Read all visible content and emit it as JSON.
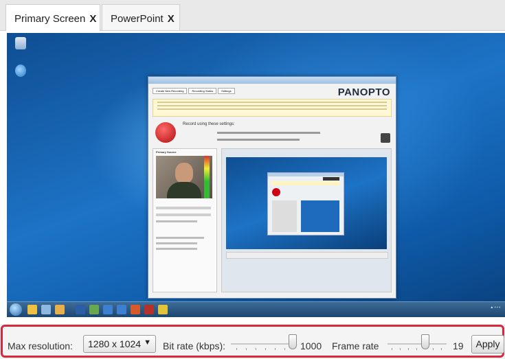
{
  "tabs": [
    {
      "label": "Primary Screen",
      "close": "X"
    },
    {
      "label": "PowerPoint",
      "close": "X"
    }
  ],
  "controls": {
    "max_resolution_label": "Max resolution:",
    "max_resolution_value": "1280 x 1024",
    "dropdown_arrow": "▼",
    "bitrate_label": "Bit rate (kbps):",
    "bitrate_value": "1000",
    "framerate_label": "Frame rate",
    "framerate_value": "19",
    "apply_label": "Apply"
  },
  "preview": {
    "logo": "PANOPTO",
    "window_tabs": [
      "Create New Recording",
      "Recording Status",
      "Settings"
    ],
    "record_heading": "Record using these settings:",
    "primary_source_label": "Primary Source"
  },
  "colors": {
    "highlight": "#d8283b",
    "desktop": "#1d73c6",
    "record_button": "#b10d0d"
  }
}
